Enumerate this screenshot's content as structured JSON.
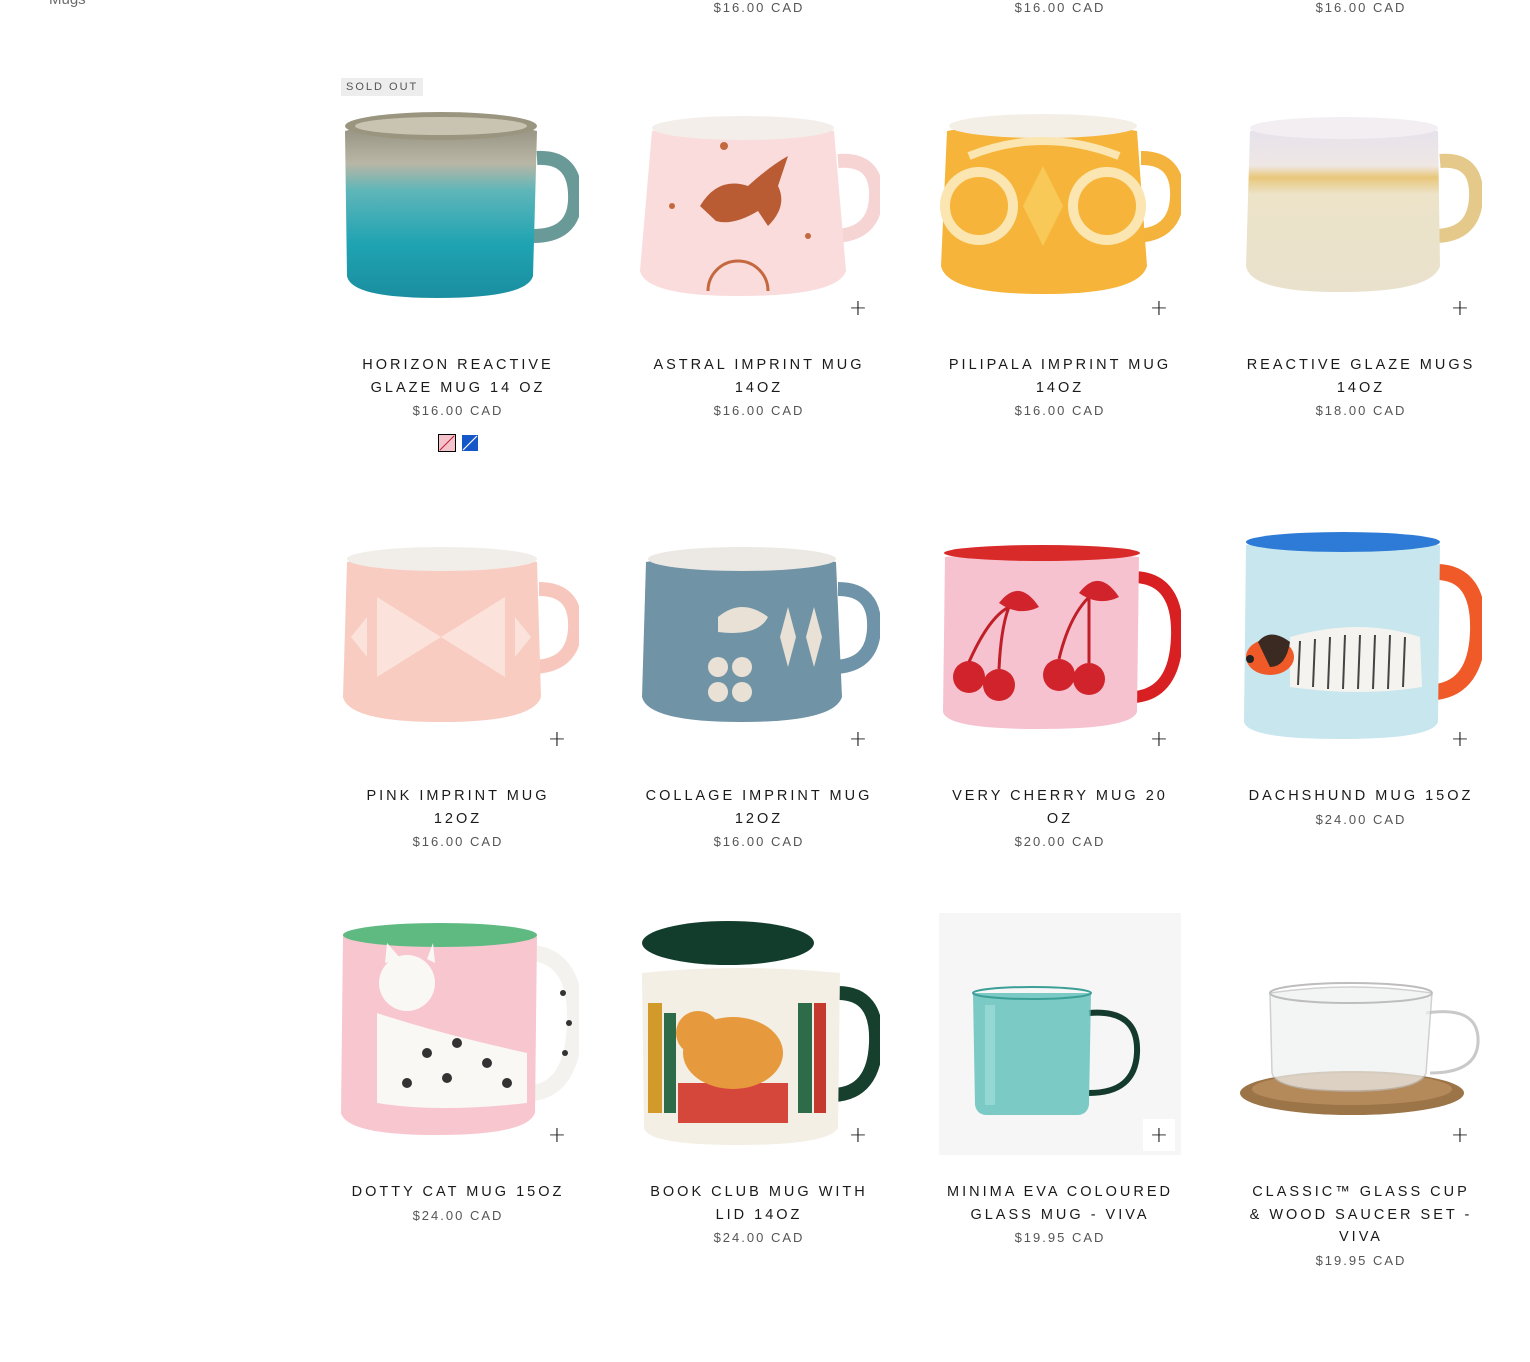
{
  "sidebar": {
    "link_label": "Mugs"
  },
  "top_row_prices": [
    "$16.00 CAD",
    "$16.00 CAD",
    "$16.00 CAD"
  ],
  "quick_add_symbol": "+",
  "products": [
    {
      "title": "Horizon Reactive Glaze Mug 14 oz",
      "price": "$16.00 CAD",
      "badge": "SOLD OUT",
      "image_icon": "horizon-mug",
      "swatch_colors": [
        "#f5c3cc",
        "#1556c8"
      ]
    },
    {
      "title": "Astral Imprint Mug 14oz",
      "price": "$16.00 CAD",
      "image_icon": "astral-mug"
    },
    {
      "title": "Pilipala Imprint Mug 14oz",
      "price": "$16.00 CAD",
      "image_icon": "pilipala-mug"
    },
    {
      "title": "Reactive Glaze Mugs 14oz",
      "price": "$18.00 CAD",
      "image_icon": "reactive-mug"
    },
    {
      "title": "Pink Imprint Mug 12oz",
      "price": "$16.00 CAD",
      "image_icon": "pink-mug"
    },
    {
      "title": "Collage Imprint Mug 12oz",
      "price": "$16.00 CAD",
      "image_icon": "collage-mug"
    },
    {
      "title": "Very Cherry Mug 20 oz",
      "price": "$20.00 CAD",
      "image_icon": "cherry-mug"
    },
    {
      "title": "Dachshund Mug 15oz",
      "price": "$24.00 CAD",
      "image_icon": "dachshund-mug"
    },
    {
      "title": "Dotty Cat Mug 15oz",
      "price": "$24.00 CAD",
      "image_icon": "cat-mug"
    },
    {
      "title": "Book Club Mug with Lid 14oz",
      "price": "$24.00 CAD",
      "image_icon": "bookclub-mug"
    },
    {
      "title": "MINIMA EVA Coloured Glass Mug - VIVA",
      "price": "$19.95 CAD",
      "image_icon": "glass-mug"
    },
    {
      "title": "CLASSIC™ Glass Cup & Wood Saucer Set - VIVA",
      "price": "$19.95 CAD",
      "image_icon": "glass-cup-saucer"
    }
  ]
}
